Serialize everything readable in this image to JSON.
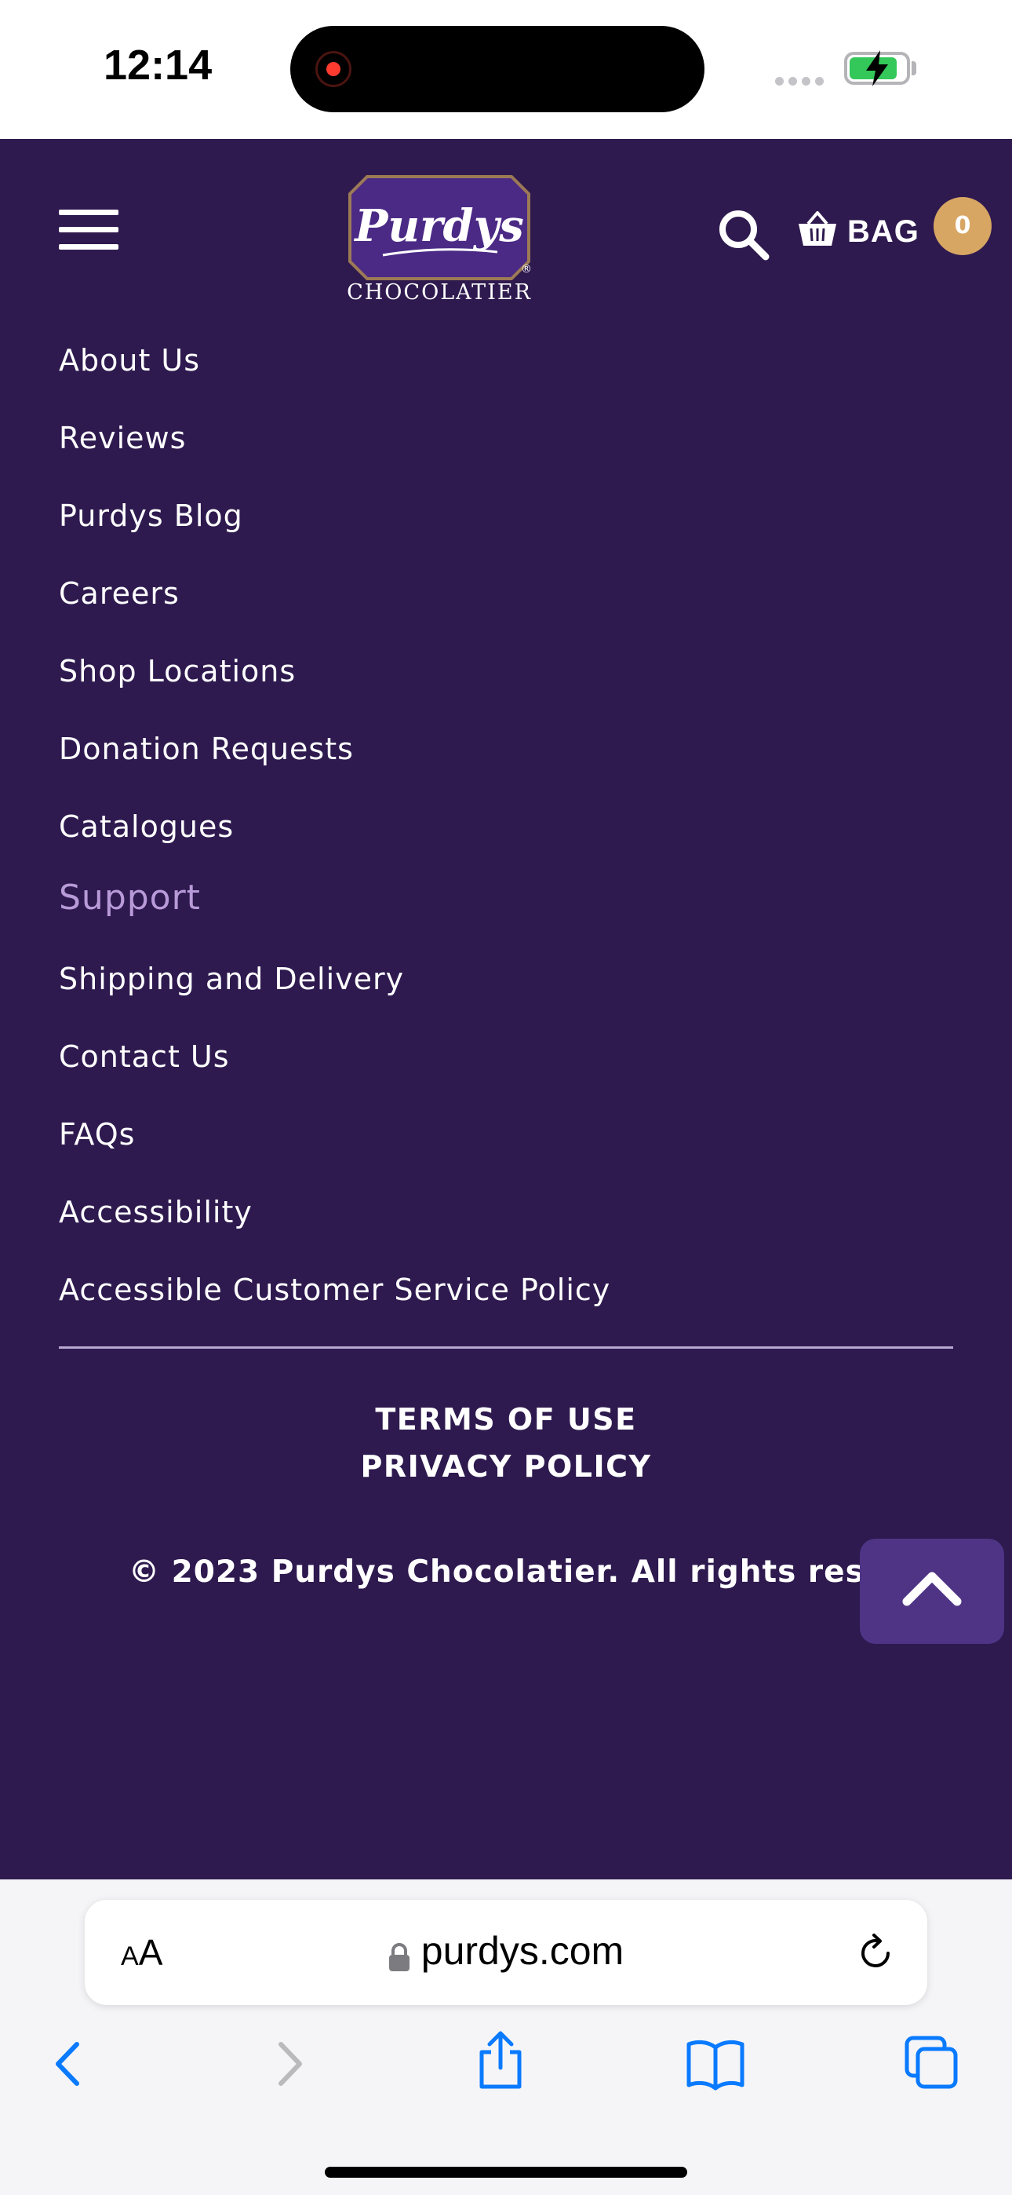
{
  "status_bar": {
    "time": "12:14",
    "icons": [
      "screen-recording-icon",
      "cellular-signal-icon",
      "battery-charging-icon"
    ],
    "battery_level": 0.85
  },
  "header": {
    "logo_text": "Purdys",
    "logo_subtitle": "CHOCOLATIER",
    "icons": [
      "hamburger-menu-icon",
      "search-icon",
      "basket-icon"
    ],
    "bag_label": "BAG",
    "bag_count": "0",
    "colors": {
      "background": "#2e1a4f",
      "badge": "#d8a663",
      "logo_panel": "#4b2a86"
    }
  },
  "company_links": [
    "About Us",
    "Reviews",
    "Purdys Blog",
    "Careers",
    "Shop Locations",
    "Donation Requests",
    "Catalogues"
  ],
  "support": {
    "heading": "Support",
    "links": [
      "Shipping and Delivery",
      "Contact Us",
      "FAQs",
      "Accessibility",
      "Accessible Customer Service Policy"
    ]
  },
  "legal": {
    "terms": "TERMS OF USE",
    "privacy": "PRIVACY POLICY",
    "copyright": "© 2023 Purdys Chocolatier. All rights reserved"
  },
  "back_to_top_icon": "chevron-up-icon",
  "browser": {
    "text_size_label": "AA",
    "url": "purdys.com",
    "icons": [
      "lock-icon",
      "reload-icon",
      "back-icon",
      "forward-icon",
      "share-icon",
      "bookmarks-icon",
      "tabs-icon"
    ],
    "accent": "#0a7aff"
  }
}
